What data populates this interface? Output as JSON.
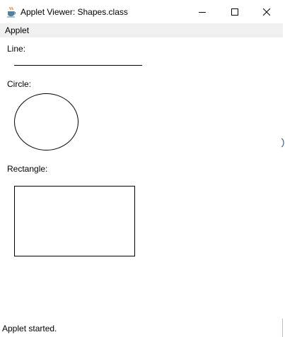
{
  "window": {
    "title": "Applet Viewer: Shapes.class",
    "icon": "java-cup-icon",
    "controls": {
      "minimize": "minimize-icon",
      "maximize": "maximize-icon",
      "close": "close-icon"
    }
  },
  "menubar": {
    "items": [
      {
        "label": "Applet"
      }
    ]
  },
  "applet": {
    "labels": {
      "line": "Line:",
      "circle": "Circle:",
      "rectangle": "Rectangle:"
    }
  },
  "status": {
    "text": "Applet started."
  },
  "colors": {
    "menubar_bg": "#f0f0f0",
    "shape_stroke": "#000000",
    "background": "#ffffff"
  }
}
